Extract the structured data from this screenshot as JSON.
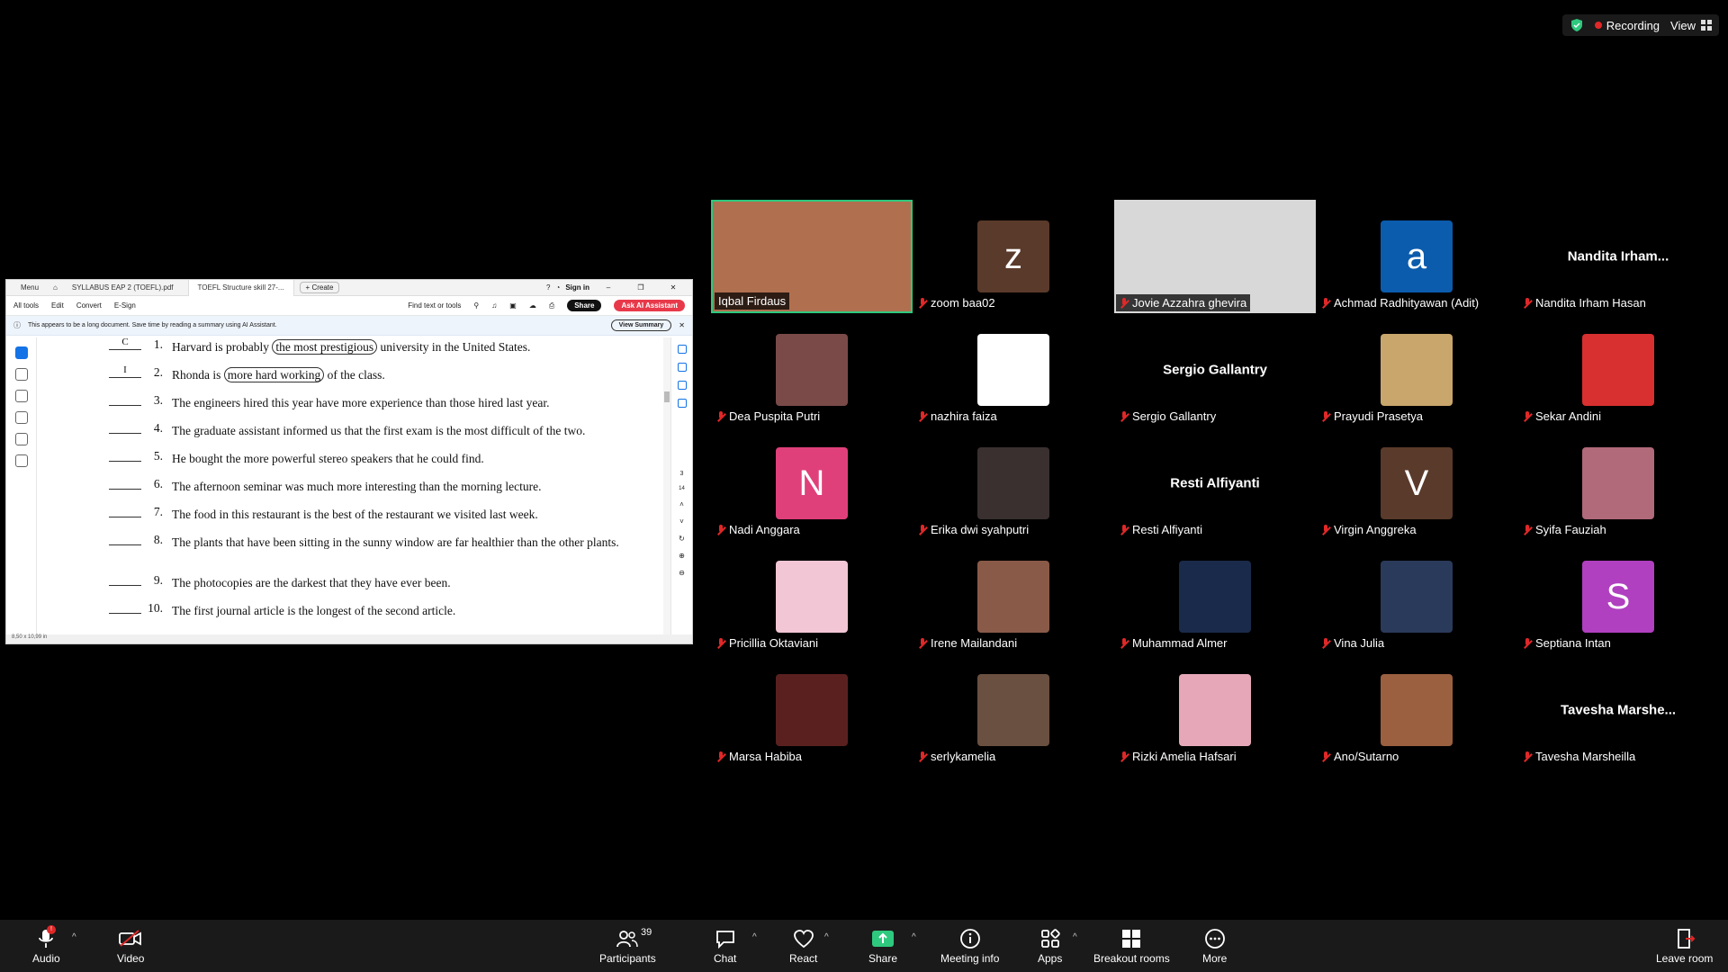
{
  "status": {
    "recording": "Recording",
    "view": "View"
  },
  "pdf": {
    "tabs": [
      "Menu",
      "SYLLABUS EAP 2 (TOEFL).pdf",
      "TOEFL Structure skill 27-...",
      "Create"
    ],
    "signin": "Sign in",
    "toolbar": [
      "All tools",
      "Edit",
      "Convert",
      "E-Sign"
    ],
    "find": "Find text or tools",
    "share": "Share",
    "ask_ai": "Ask AI Assistant",
    "banner": "This appears to be a long document. Save time by reading a summary using AI Assistant.",
    "view_summary": "View Summary",
    "page_dims": "8,50 x 10,99 in",
    "page_num": "3",
    "page_total": "14",
    "questions": [
      {
        "answer": "C",
        "num": "1.",
        "pre": "Harvard is probably ",
        "circ": "the most prestigious",
        "post": " university in the United States."
      },
      {
        "answer": "I",
        "num": "2.",
        "pre": "Rhonda is ",
        "circ": "more hard working",
        "post": " of the class."
      },
      {
        "answer": "",
        "num": "3.",
        "pre": "The engineers hired this year have more experience than those hired last year.",
        "circ": "",
        "post": ""
      },
      {
        "answer": "",
        "num": "4.",
        "pre": "The graduate assistant informed us that the first exam is the most difficult of the two.",
        "circ": "",
        "post": ""
      },
      {
        "answer": "",
        "num": "5.",
        "pre": "He bought the more powerful stereo speakers that he could find.",
        "circ": "",
        "post": ""
      },
      {
        "answer": "",
        "num": "6.",
        "pre": "The afternoon seminar was much more interesting than the morning lecture.",
        "circ": "",
        "post": ""
      },
      {
        "answer": "",
        "num": "7.",
        "pre": "The food in this restaurant is the best of the restaurant we visited last week.",
        "circ": "",
        "post": ""
      },
      {
        "answer": "",
        "num": "8.",
        "pre": "The plants that have been sitting in the sunny window are far healthier than the other plants.",
        "circ": "",
        "post": ""
      },
      {
        "answer": "",
        "num": "9.",
        "pre": "The photocopies are the darkest that they have ever been.",
        "circ": "",
        "post": ""
      },
      {
        "answer": "",
        "num": "10.",
        "pre": "The first journal article is the longest of the second article.",
        "circ": "",
        "post": ""
      }
    ]
  },
  "participants": [
    {
      "name": "Iqbal Firdaus",
      "type": "video",
      "muted": false,
      "active": true,
      "color": "#b07050"
    },
    {
      "name": "zoom baa02",
      "type": "letter",
      "letter": "z",
      "color": "#5a3a2a",
      "muted": true
    },
    {
      "name": "Jovie Azzahra ghevira",
      "type": "video",
      "muted": true,
      "color": "#d8d8d8"
    },
    {
      "name": "Achmad Radhityawan (Adit)",
      "type": "letter",
      "letter": "a",
      "color": "#0b5cad",
      "muted": true
    },
    {
      "name": "Nandita Irham Hasan",
      "type": "text",
      "big": "Nandita  Irham...",
      "muted": true
    },
    {
      "name": "Dea Puspita Putri",
      "type": "photo",
      "color": "#7a4a48",
      "muted": true
    },
    {
      "name": "nazhira faiza",
      "type": "photo",
      "color": "#ffffff",
      "muted": true
    },
    {
      "name": "Sergio Gallantry",
      "type": "text",
      "big": "Sergio Gallantry",
      "muted": true
    },
    {
      "name": "Prayudi Prasetya",
      "type": "photo",
      "color": "#c9a66b",
      "muted": true
    },
    {
      "name": "Sekar Andini",
      "type": "photo",
      "color": "#d83030",
      "muted": true
    },
    {
      "name": "Nadi Anggara",
      "type": "letter",
      "letter": "N",
      "color": "#e0407a",
      "muted": true
    },
    {
      "name": "Erika dwi syahputri",
      "type": "photo",
      "color": "#3a3030",
      "muted": true
    },
    {
      "name": "Resti Alfiyanti",
      "type": "text",
      "big": "Resti Alfiyanti",
      "muted": true
    },
    {
      "name": "Virgin Anggreka",
      "type": "letter",
      "letter": "V",
      "color": "#5a3a2a",
      "muted": true
    },
    {
      "name": "Syifa Fauziah",
      "type": "photo",
      "color": "#b06a7a",
      "muted": true
    },
    {
      "name": "Pricillia Oktaviani",
      "type": "photo",
      "color": "#f2c6d4",
      "muted": true
    },
    {
      "name": "Irene Mailandani",
      "type": "photo",
      "color": "#8a5a48",
      "muted": true
    },
    {
      "name": "Muhammad Almer",
      "type": "photo",
      "color": "#1a2a4a",
      "muted": true
    },
    {
      "name": "Vina Julia",
      "type": "photo",
      "color": "#2a3a5a",
      "muted": true
    },
    {
      "name": "Septiana Intan",
      "type": "letter",
      "letter": "S",
      "color": "#b040c0",
      "muted": true
    },
    {
      "name": "Marsa Habiba",
      "type": "photo",
      "color": "#5a2020",
      "muted": true
    },
    {
      "name": "serlykamelia",
      "type": "photo",
      "color": "#6a5040",
      "muted": true
    },
    {
      "name": "Rizki Amelia Hafsari",
      "type": "photo",
      "color": "#e6a8b8",
      "muted": true
    },
    {
      "name": "Ano/Sutarno",
      "type": "photo",
      "color": "#9a6040",
      "muted": true
    },
    {
      "name": "Tavesha Marsheilla",
      "type": "text",
      "big": "Tavesha  Marshe...",
      "muted": true
    }
  ],
  "toolbar": {
    "audio": "Audio",
    "video": "Video",
    "participants": "Participants",
    "participants_count": "39",
    "chat": "Chat",
    "react": "React",
    "share": "Share",
    "meeting_info": "Meeting info",
    "apps": "Apps",
    "breakout": "Breakout rooms",
    "more": "More",
    "leave": "Leave room"
  }
}
